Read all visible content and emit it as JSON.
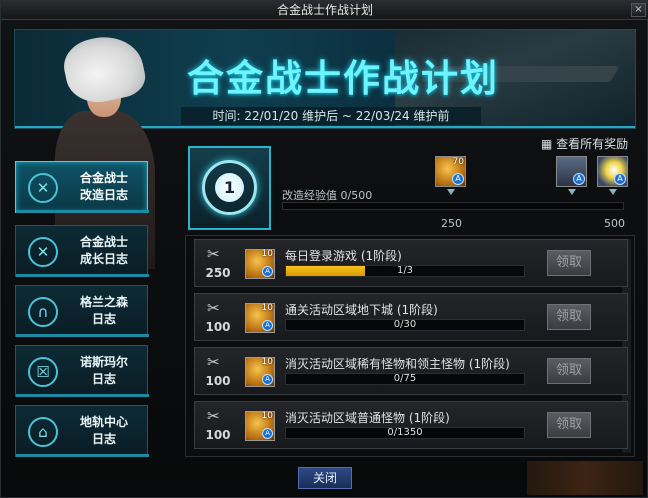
{
  "window": {
    "title": "合金战士作战计划",
    "close_glyph": "×"
  },
  "banner": {
    "title": "合金战士作战计划",
    "date_text": "时间: 22/01/20 维护后 ~ 22/03/24 维护前"
  },
  "sidebar": {
    "items": [
      {
        "label_line1": "合金战士",
        "label_line2": "改造日志",
        "icon": "target-badge-icon",
        "active": true
      },
      {
        "label_line1": "合金战士",
        "label_line2": "成长日志",
        "icon": "target-badge-icon",
        "active": false
      },
      {
        "label_line1": "格兰之森",
        "label_line2": "日志",
        "icon": "gate-icon",
        "active": false
      },
      {
        "label_line1": "诺斯玛尔",
        "label_line2": "日志",
        "icon": "door-icon",
        "active": false
      },
      {
        "label_line1": "地轨中心",
        "label_line2": "日志",
        "icon": "city-icon",
        "active": false
      }
    ]
  },
  "level": {
    "value": "1"
  },
  "progress": {
    "label": "改造经验值 0/500",
    "current": 0,
    "max": 500,
    "marks": [
      "250",
      "500"
    ]
  },
  "rewards": {
    "view_all": "查看所有奖励",
    "items": [
      {
        "quantity": "70",
        "badge": "A",
        "icon": "gold-coin-icon"
      },
      {
        "quantity": "",
        "badge": "A",
        "icon": "potion-jar-icon"
      },
      {
        "quantity": "",
        "badge": "A",
        "icon": "flash-icon"
      }
    ]
  },
  "tasks": [
    {
      "points": "250",
      "reward_qty": "10",
      "badge": "A",
      "name": "每日登录游戏 (1阶段)",
      "progress_text": "1/3",
      "progress_fraction": 0.333,
      "claim_label": "领取"
    },
    {
      "points": "100",
      "reward_qty": "10",
      "badge": "A",
      "name": "通关活动区域地下城 (1阶段)",
      "progress_text": "0/30",
      "progress_fraction": 0,
      "claim_label": "领取"
    },
    {
      "points": "100",
      "reward_qty": "10",
      "badge": "A",
      "name": "消灭活动区域稀有怪物和领主怪物 (1阶段)",
      "progress_text": "0/75",
      "progress_fraction": 0,
      "claim_label": "领取"
    },
    {
      "points": "100",
      "reward_qty": "10",
      "badge": "A",
      "name": "消灭活动区域普通怪物 (1阶段)",
      "progress_text": "0/1350",
      "progress_fraction": 0,
      "claim_label": "领取"
    }
  ],
  "footer": {
    "close_label": "关闭"
  }
}
